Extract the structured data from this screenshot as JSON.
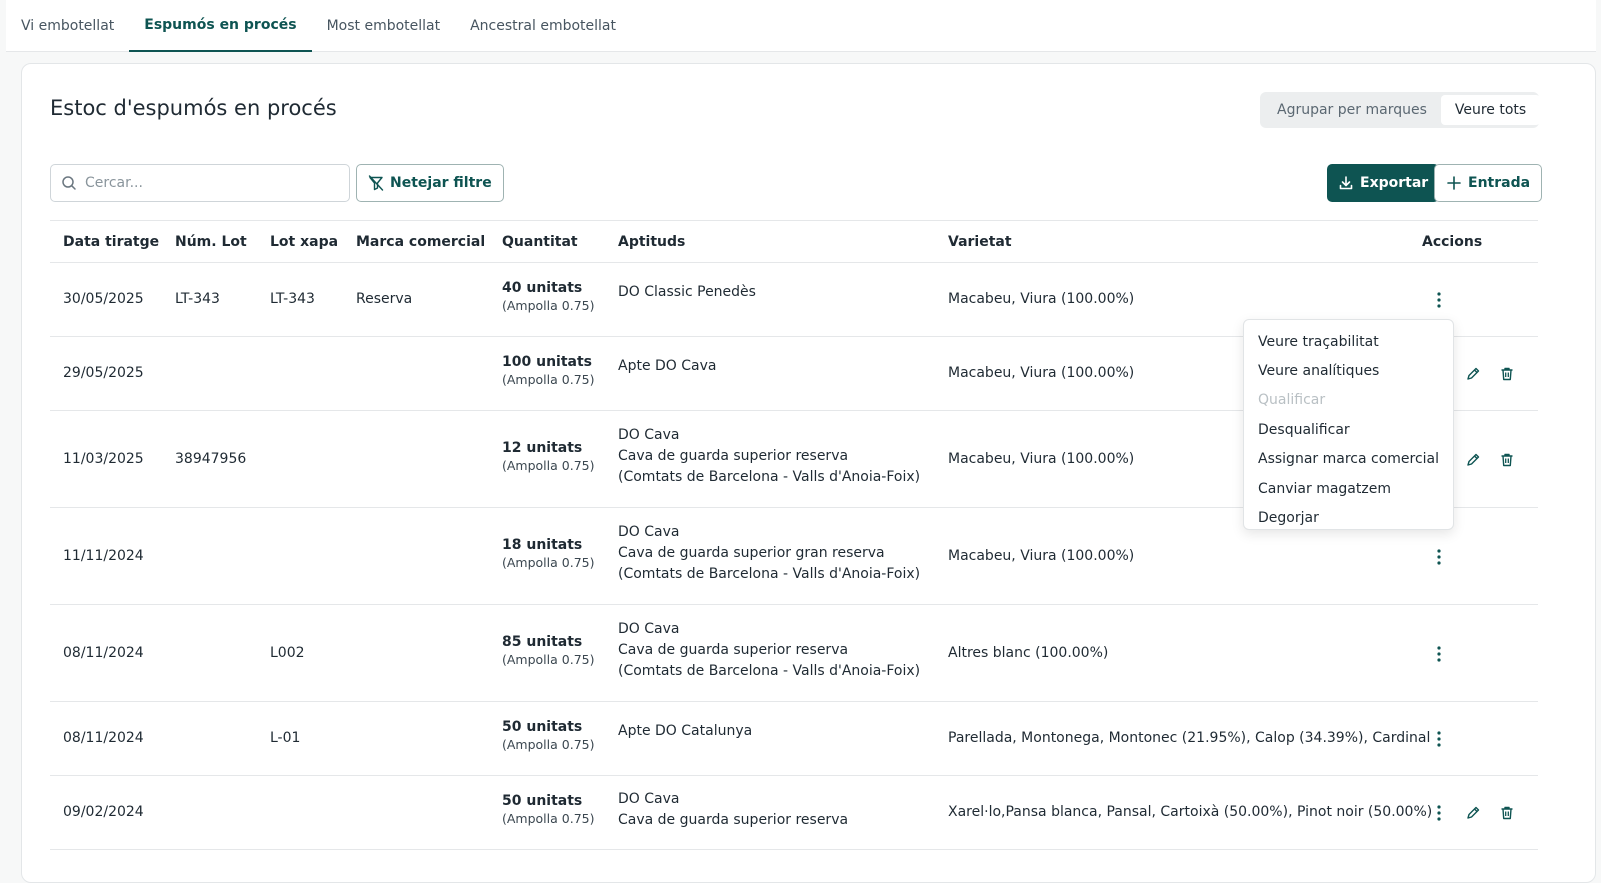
{
  "tabs": [
    {
      "label": "Vi embotellat",
      "active": false
    },
    {
      "label": "Espumós en procés",
      "active": true
    },
    {
      "label": "Most embotellat",
      "active": false
    },
    {
      "label": "Ancestral embotellat",
      "active": false
    }
  ],
  "page": {
    "title": "Estoc d'espumós en procés",
    "toggle": {
      "group_label": "Agrupar per marques",
      "all_label": "Veure tots",
      "selected": "Veure tots"
    }
  },
  "toolbar": {
    "search_placeholder": "Cercar...",
    "clear_filter_label": "Netejar filtre",
    "export_label": "Exportar",
    "entry_label": "Entrada"
  },
  "table": {
    "columns": [
      "Data tiratge",
      "Núm. Lot",
      "Lot xapa",
      "Marca comercial",
      "Quantitat",
      "Aptituds",
      "Varietat",
      "Accions"
    ],
    "rows": [
      {
        "date": "30/05/2025",
        "lot": "LT-343",
        "cap_lot": "LT-343",
        "brand": "Reserva",
        "qty": "40 unitats",
        "qty_unit": "(Ampolla 0.75)",
        "aptitudes": [
          "DO Classic Penedès"
        ],
        "variety": "Macabeu, Viura (100.00%)",
        "edit": false
      },
      {
        "date": "29/05/2025",
        "lot": "",
        "cap_lot": "",
        "brand": "",
        "qty": "100 unitats",
        "qty_unit": "(Ampolla 0.75)",
        "aptitudes": [
          "Apte DO Cava"
        ],
        "variety": "Macabeu, Viura (100.00%)",
        "edit": true
      },
      {
        "date": "11/03/2025",
        "lot": "38947956",
        "cap_lot": "",
        "brand": "",
        "qty": "12 unitats",
        "qty_unit": "(Ampolla 0.75)",
        "aptitudes": [
          "DO Cava",
          "Cava de guarda superior reserva",
          "(Comtats de Barcelona - Valls d'Anoia-Foix)"
        ],
        "variety": "Macabeu, Viura (100.00%)",
        "edit": true
      },
      {
        "date": "11/11/2024",
        "lot": "",
        "cap_lot": "",
        "brand": "",
        "qty": "18 unitats",
        "qty_unit": "(Ampolla 0.75)",
        "aptitudes": [
          "DO Cava",
          "Cava de guarda superior gran reserva",
          "(Comtats de Barcelona - Valls d'Anoia-Foix)"
        ],
        "variety": "Macabeu, Viura (100.00%)",
        "edit": false
      },
      {
        "date": "08/11/2024",
        "lot": "",
        "cap_lot": "L002",
        "brand": "",
        "qty": "85 unitats",
        "qty_unit": "(Ampolla 0.75)",
        "aptitudes": [
          "DO Cava",
          "Cava de guarda superior reserva",
          "(Comtats de Barcelona - Valls d'Anoia-Foix)"
        ],
        "variety": "Altres blanc (100.00%)",
        "edit": false
      },
      {
        "date": "08/11/2024",
        "lot": "",
        "cap_lot": "L-01",
        "brand": "",
        "qty": "50 unitats",
        "qty_unit": "(Ampolla 0.75)",
        "aptitudes": [
          "Apte DO Catalunya"
        ],
        "variety": "Parellada, Montonega, Montonec (21.95%), Calop (34.39%), Cardinal",
        "edit": false
      },
      {
        "date": "09/02/2024",
        "lot": "",
        "cap_lot": "",
        "brand": "",
        "qty": "50 unitats",
        "qty_unit": "(Ampolla 0.75)",
        "aptitudes": [
          "DO Cava",
          "Cava de guarda superior reserva"
        ],
        "variety": "Xarel·lo,Pansa blanca, Pansal, Cartoixà (50.00%), Pinot noir (50.00%)",
        "edit": true
      }
    ]
  },
  "actions_menu": {
    "items": [
      {
        "label": "Veure traçabilitat",
        "disabled": false
      },
      {
        "label": "Veure analítiques",
        "disabled": false
      },
      {
        "label": "Qualificar",
        "disabled": true
      },
      {
        "label": "Desqualificar",
        "disabled": false
      },
      {
        "label": "Assignar marca comercial",
        "disabled": false
      },
      {
        "label": "Canviar magatzem",
        "disabled": false
      },
      {
        "label": "Degorjar",
        "disabled": false
      }
    ]
  },
  "colors": {
    "primary": "#0e5452",
    "border": "#e5e7e9",
    "text": "#1f2a33"
  },
  "icons": {
    "search": "search-icon",
    "filter_clear": "filter-off-icon",
    "export": "download-icon",
    "entry": "plus-icon",
    "row_menu": "kebab-icon",
    "edit": "pencil-icon",
    "delete": "trash-icon"
  }
}
